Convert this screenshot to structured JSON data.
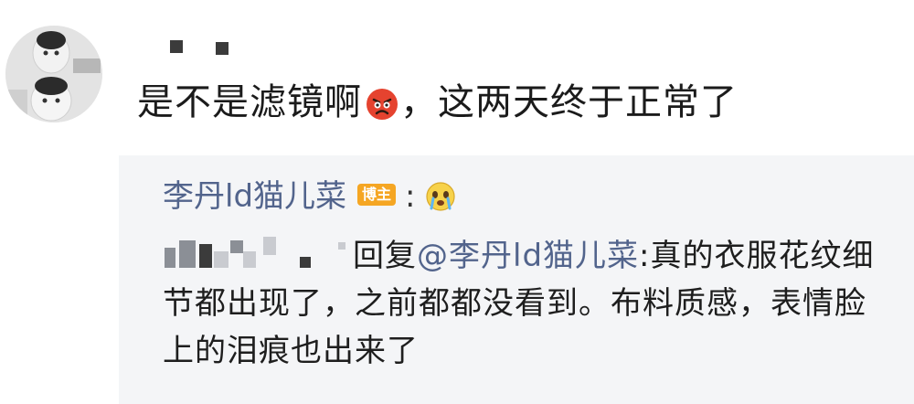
{
  "comment": {
    "text_before": "是不是滤镜啊",
    "emoji": "angry-face-emoji",
    "text_after": "，这两天终于正常了"
  },
  "reply": {
    "author": "李丹ld猫儿菜",
    "badge": "博主",
    "colon": ":",
    "emoji": "crying-face-emoji",
    "prefix": "回复",
    "mention": "@李丹ld猫儿菜",
    "body": ":真的衣服花纹细节都出现了，之前都都没看到。布料质感，表情脸上的泪痕也出来了"
  },
  "colors": {
    "link": "#52648c",
    "badge": "#f5a623",
    "reply_background": "#f4f5f7"
  }
}
